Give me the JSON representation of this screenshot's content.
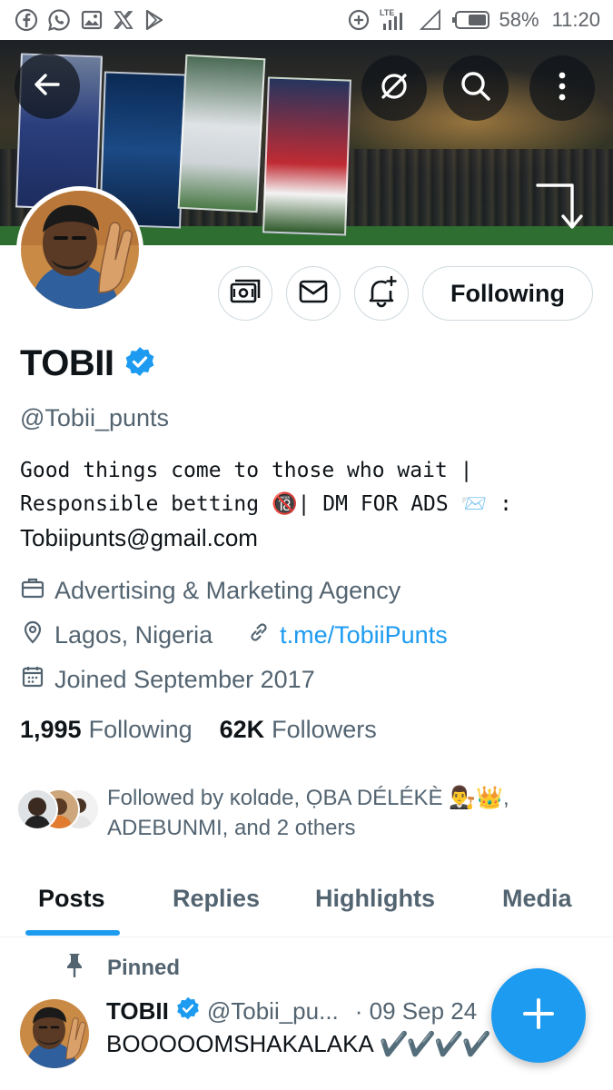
{
  "status_bar": {
    "left_icons": [
      "facebook-icon",
      "whatsapp-icon",
      "gallery-icon",
      "x-icon",
      "play-store-icon"
    ],
    "network_label": "LTE",
    "battery": "58%",
    "time": "11:20"
  },
  "header": {
    "back_icon": "arrow-left-icon",
    "actions": [
      "bell-off-icon",
      "search-icon",
      "more-vertical-icon"
    ]
  },
  "profile": {
    "display_name": "TOBII",
    "verified": true,
    "handle": "@Tobii_punts",
    "bio_line1": "Good things come to those who wait |",
    "bio_line2": "Responsible betting 🔞| DM FOR ADS 📨 :",
    "bio_email": "Tobiipunts@gmail.com",
    "category": "Advertising & Marketing Agency",
    "location": "Lagos, Nigeria",
    "link": "t.me/TobiiPunts",
    "joined": "Joined September 2017",
    "following_count": "1,995",
    "following_label": "Following",
    "followers_count": "62K",
    "followers_label": "Followers",
    "followed_by": "Followed by ĸolɑde, ỌBA DÉLÉKÈ 👨‍⚖️👑, ADEBUNMI, and 2 others"
  },
  "actions": {
    "follow_state": "Following"
  },
  "tabs": [
    {
      "label": "Posts",
      "active": true
    },
    {
      "label": "Replies",
      "active": false
    },
    {
      "label": "Highlights",
      "active": false
    },
    {
      "label": "Media",
      "active": false
    }
  ],
  "pinned_post": {
    "pinned_label": "Pinned",
    "author": "TOBII",
    "handle": "@Tobii_pu...",
    "date": "· 09 Sep 24",
    "text": "BOOOOOMSHAKALAKA",
    "checkmarks": "✔️✔️✔️✔️"
  },
  "colors": {
    "accent": "#1d9bf0",
    "text_primary": "#0f1419",
    "text_secondary": "#536471",
    "border": "#cfd9de"
  }
}
